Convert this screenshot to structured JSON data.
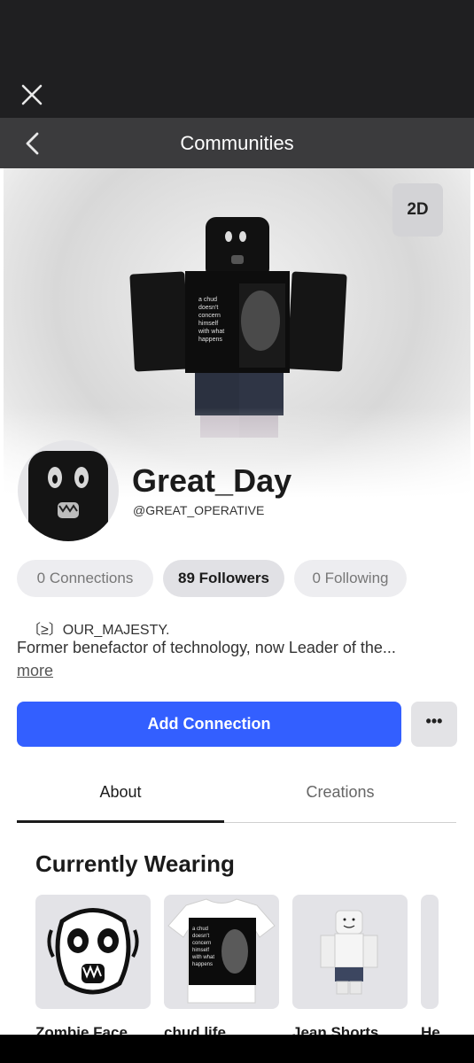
{
  "nav": {
    "title": "Communities"
  },
  "hero": {
    "view_toggle": "2D",
    "shirt_text": [
      "a chud",
      "doesn't",
      "concern",
      "himself",
      "with what",
      "happens"
    ]
  },
  "profile": {
    "display_name": "Great_Day",
    "username": "@GREAT_OPERATIVE"
  },
  "stats": [
    {
      "label": "0 Connections"
    },
    {
      "label": "89 Followers"
    },
    {
      "label": "0 Following"
    }
  ],
  "bio": {
    "line1": "〔≥〕OUR_MAJESTY.",
    "line2": "Former benefactor of technology, now Leader of the...",
    "more": "more"
  },
  "actions": {
    "add_connection": "Add Connection",
    "more": "•••"
  },
  "tabs": [
    {
      "label": "About"
    },
    {
      "label": "Creations"
    }
  ],
  "wearing": {
    "title": "Currently Wearing",
    "items": [
      {
        "name": "Zombie Face"
      },
      {
        "name": "chud life"
      },
      {
        "name": "Jean Shorts"
      },
      {
        "name": "He"
      }
    ]
  },
  "colors": {
    "primary": "#335fff",
    "header": "#3b3b3d",
    "statusbar": "#1f1f21"
  }
}
